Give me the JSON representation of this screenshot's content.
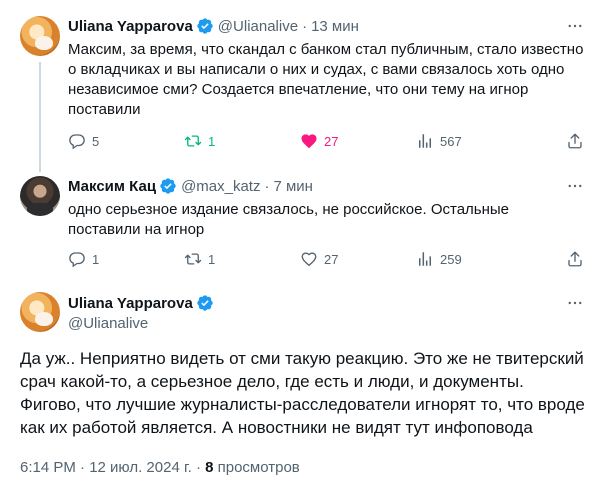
{
  "tweets": [
    {
      "author": "Uliana Yapparova",
      "handle": "@Ulianalive",
      "time": "13 мин",
      "text": "Максим, за время, что скандал с банком стал публичным, стало известно о вкладчиках и вы написали о них и судах, с вами связалось хоть одно независимое сми? Создается впечатление, что они тему на игнор поставили",
      "replies": "5",
      "reposts": "1",
      "likes": "27",
      "views": "567"
    },
    {
      "author": "Максим Кац",
      "handle": "@max_katz",
      "time": "7 мин",
      "text": "одно серьезное издание связалось, не российское. Остальные поставили на игнор",
      "replies": "1",
      "reposts": "1",
      "likes": "27",
      "views": "259"
    }
  ],
  "main_tweet": {
    "author": "Uliana Yapparova",
    "handle": "@Ulianalive",
    "text": "Да уж.. Неприятно видеть от сми такую реакцию. Это же не твитерский срач какой-то, а серьезное дело, где есть и люди, и документы. Фигово, что лучшие журналисты-расследователи игнорят то, что вроде как их работой является. А новостники не видят тут инфоповода",
    "timestamp": "6:14 PM · 12 июл. 2024 г. · ",
    "views_count": "8",
    "views_label": " просмотров"
  },
  "separator": "·",
  "colors": {
    "verified": "#1d9bf0",
    "repost_active": "#00ba7c",
    "like_active": "#f91880",
    "muted": "#536471"
  },
  "icons": [
    "verified-badge-icon",
    "more-icon",
    "reply-icon",
    "repost-icon",
    "like-icon",
    "views-icon",
    "share-icon"
  ]
}
